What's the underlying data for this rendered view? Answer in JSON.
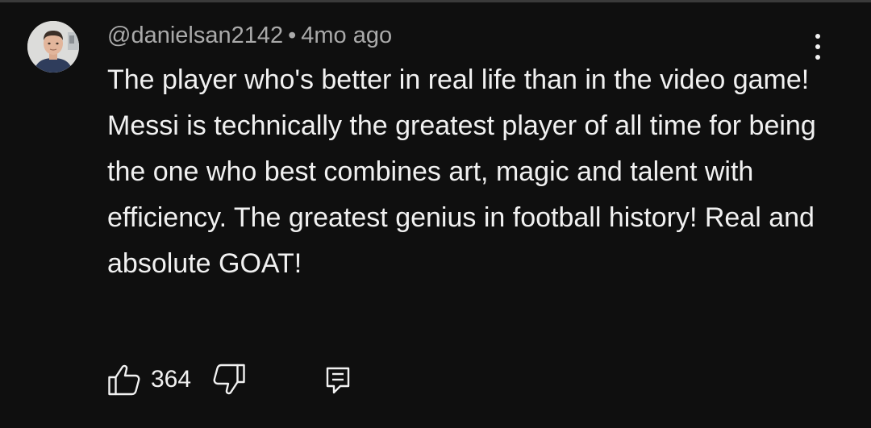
{
  "comment": {
    "author": "@danielsan2142",
    "separator": "•",
    "timestamp": "4mo ago",
    "text": "The player who's better in real life than in the video game! Messi is technically the greatest player of all time for being the one who best combines art, magic and talent with efficiency. The greatest genius in football history! Real and absolute GOAT!",
    "like_count": "364"
  },
  "icons": {
    "avatar": "avatar",
    "menu": "more-vert-icon",
    "like": "thumbs-up-icon",
    "dislike": "thumbs-down-icon",
    "reply": "reply-comment-icon"
  },
  "colors": {
    "background": "#0f0f0f",
    "primary_text": "#f1f1f1",
    "secondary_text": "#aaaaaa"
  }
}
